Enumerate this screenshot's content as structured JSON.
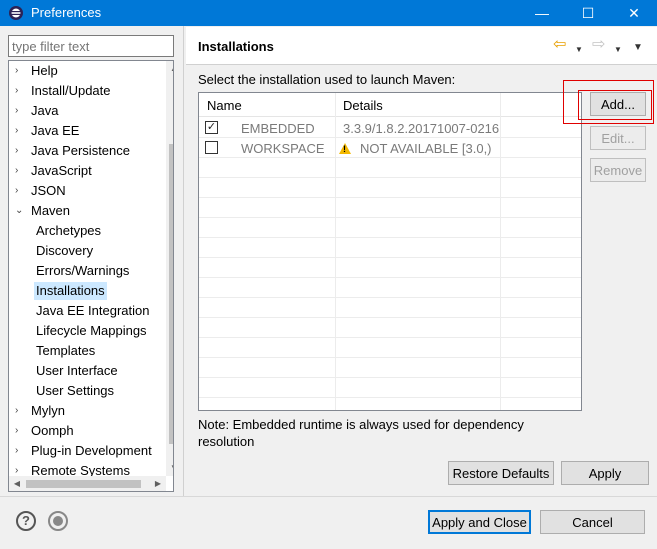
{
  "window": {
    "title": "Preferences",
    "controls": {
      "minimize": "—",
      "maximize": "☐",
      "close": "✕"
    }
  },
  "filter": {
    "placeholder": "type filter text"
  },
  "tree": {
    "items": [
      {
        "label": "Help",
        "expander": "›",
        "level": 0
      },
      {
        "label": "Install/Update",
        "expander": "›",
        "level": 0
      },
      {
        "label": "Java",
        "expander": "›",
        "level": 0
      },
      {
        "label": "Java EE",
        "expander": "›",
        "level": 0
      },
      {
        "label": "Java Persistence",
        "expander": "›",
        "level": 0
      },
      {
        "label": "JavaScript",
        "expander": "›",
        "level": 0
      },
      {
        "label": "JSON",
        "expander": "›",
        "level": 0
      },
      {
        "label": "Maven",
        "expander": "⌄",
        "level": 0
      },
      {
        "label": "Archetypes",
        "expander": "",
        "level": 1
      },
      {
        "label": "Discovery",
        "expander": "",
        "level": 1
      },
      {
        "label": "Errors/Warnings",
        "expander": "",
        "level": 1
      },
      {
        "label": "Installations",
        "expander": "",
        "level": 1,
        "selected": true
      },
      {
        "label": "Java EE Integration",
        "expander": "",
        "level": 1
      },
      {
        "label": "Lifecycle Mappings",
        "expander": "",
        "level": 1
      },
      {
        "label": "Templates",
        "expander": "",
        "level": 1
      },
      {
        "label": "User Interface",
        "expander": "",
        "level": 1
      },
      {
        "label": "User Settings",
        "expander": "",
        "level": 1
      },
      {
        "label": "Mylyn",
        "expander": "›",
        "level": 0
      },
      {
        "label": "Oomph",
        "expander": "›",
        "level": 0
      },
      {
        "label": "Plug-in Development",
        "expander": "›",
        "level": 0
      },
      {
        "label": "Remote Systems",
        "expander": "›",
        "level": 0
      }
    ]
  },
  "page": {
    "title": "Installations",
    "description": "Select the installation used to launch Maven:",
    "columns": {
      "name": "Name",
      "details": "Details"
    },
    "rows": [
      {
        "checked": true,
        "check_glyph": "✓",
        "name": "EMBEDDED",
        "details": "3.3.9/1.8.2.20171007-0216",
        "warning": false
      },
      {
        "checked": false,
        "check_glyph": "",
        "name": "WORKSPACE",
        "details": "NOT AVAILABLE [3.0,)",
        "warning": true
      }
    ],
    "note": "Note: Embedded runtime is always used for dependency resolution"
  },
  "buttons": {
    "add": "Add...",
    "edit": "Edit...",
    "remove": "Remove",
    "restore_defaults": "Restore Defaults",
    "apply": "Apply",
    "apply_and_close": "Apply and Close",
    "cancel": "Cancel"
  },
  "icons": {
    "app": "eclipse-icon",
    "back": "back-arrow-icon",
    "forward": "forward-arrow-icon",
    "help": "help-icon",
    "record": "record-icon",
    "warning": "warning-icon"
  },
  "colors": {
    "titlebar": "#0078d7",
    "selection": "#cce8ff",
    "highlight": "#e00000",
    "warning": "#f3b800"
  }
}
